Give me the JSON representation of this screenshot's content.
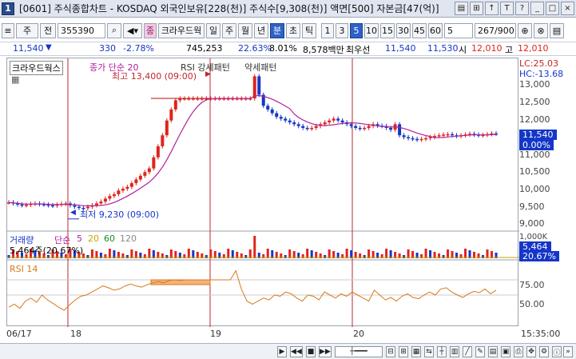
{
  "window": {
    "badge": "1",
    "title": "[0601] 주식종합차트 - KOSDAQ 외국인보유[228(천)] 주식수[9,308(천)] 액면[500] 자본금[47(억)]",
    "controls": [
      "▤",
      "⊞",
      "↑",
      "T",
      "?",
      "_",
      "□",
      "×"
    ]
  },
  "toolbar": {
    "menu_btn": "≡",
    "type_select": "주",
    "prev_btn": "전",
    "code": "355390",
    "search_icon": "⌕",
    "sound_icon": "◀▾",
    "stock_tag": "종",
    "stock_name": "크라우드웍",
    "periods": [
      "일",
      "주",
      "월",
      "년",
      "분",
      "초",
      "틱"
    ],
    "active_period": "분",
    "intervals": [
      "1",
      "3",
      "5",
      "10",
      "15",
      "30",
      "45",
      "60"
    ],
    "active_interval": "5",
    "interval_select": "5",
    "count": "267/900",
    "tools": [
      "⊕",
      "⊗",
      "▤"
    ]
  },
  "quote": {
    "price": "11,540",
    "arrow": "▼",
    "change": "330",
    "change_pct": "-2.78%",
    "volume": "745,253",
    "vol_ratio": "22.63%",
    "turnover": "8.01%",
    "amount": "8,578백만",
    "hoga_label": "최우선",
    "ask": "11,540",
    "bid": "11,530",
    "open_label": "시",
    "open": "12,010",
    "high_label": "고",
    "high": "12,010"
  },
  "price_panel": {
    "legend_name": "크라우드웍스",
    "legend_ma": "종가 단순 20",
    "legend_rsi_pattern": "RSI 강세패턴",
    "legend_weak": "약세패턴",
    "max_label": "최고 13,400 (09:00)",
    "min_label": "최저 9,230 (09:00)",
    "lc": "LC:25.03",
    "hc": "HC:-13.68",
    "y_ticks": [
      "13,000",
      "12,500",
      "12,000",
      "11,000",
      "10,500",
      "10,000",
      "9,500",
      "9,000"
    ],
    "last_price": "11,540",
    "last_pct": "0.00%"
  },
  "volume_panel": {
    "label": "거래량",
    "ma_label": "단순",
    "ma_periods": [
      "5",
      "20",
      "60",
      "120"
    ],
    "current": "5,464주(20.67%)",
    "axis_top": "1,000K",
    "last_value": "5,464",
    "last_pct": "20.67%"
  },
  "rsi_panel": {
    "label": "RSI 14",
    "ticks": [
      "75.00",
      "50.00"
    ]
  },
  "dates": [
    "06/17",
    "18",
    "19",
    "20"
  ],
  "time_label": "15:35:00",
  "colors": {
    "up": "#e0241b",
    "down": "#1436c8",
    "ma20": "#b0209a",
    "rsi": "#d9781c",
    "divider": "#c1272d"
  },
  "chart_data": {
    "type": "candlestick",
    "interval": "5min",
    "series_ma": "종가 단순 20",
    "ylim": [
      8900,
      13500
    ],
    "dates": [
      "06/17",
      "06/18",
      "06/19",
      "06/20"
    ],
    "close_path": [
      9680,
      9650,
      9620,
      9600,
      9610,
      9640,
      9650,
      9630,
      9620,
      9600,
      9590,
      9620,
      9640,
      9650,
      9600,
      9560,
      9530,
      9520,
      9560,
      9600,
      9650,
      9700,
      9780,
      9850,
      9900,
      10000,
      10050,
      10100,
      10200,
      10300,
      10400,
      10500,
      10600,
      10900,
      11200,
      11500,
      11900,
      12200,
      12450,
      12500,
      12500,
      12500,
      12500,
      12500,
      12500,
      12500,
      12500,
      12500,
      12500,
      12500,
      12500,
      12500,
      12500,
      12500,
      12500,
      12500,
      13100,
      12600,
      12300,
      12200,
      12100,
      12000,
      11950,
      11900,
      11850,
      11800,
      11750,
      11700,
      11680,
      11700,
      11750,
      11800,
      11850,
      11900,
      11950,
      11900,
      11850,
      11800,
      11750,
      11700,
      11680,
      11700,
      11750,
      11800,
      11760,
      11750,
      11700,
      11650,
      11800,
      11500,
      11450,
      11420,
      11400,
      11380,
      11400,
      11420,
      11450,
      11480,
      11500,
      11520,
      11530,
      11500,
      11480,
      11500,
      11520,
      11540,
      11520,
      11500,
      11510,
      11530,
      11550,
      11540
    ],
    "high": 13400,
    "low": 9230,
    "last": 11540,
    "rsi_values": [
      30,
      35,
      28,
      40,
      45,
      38,
      50,
      42,
      36,
      30,
      25,
      34,
      42,
      48,
      50,
      55,
      60,
      65,
      62,
      58,
      60,
      65,
      68,
      65,
      63,
      67,
      70,
      72,
      70,
      74,
      75,
      74,
      75,
      75,
      75,
      75,
      75,
      75,
      75,
      75,
      75,
      90,
      60,
      40,
      35,
      40,
      45,
      42,
      50,
      48,
      55,
      52,
      45,
      40,
      50,
      48,
      42,
      55,
      50,
      45,
      52,
      48,
      55,
      50,
      45,
      40,
      58,
      50,
      42,
      46,
      40,
      48,
      52,
      46,
      44,
      50,
      55,
      50,
      60,
      62,
      55,
      50,
      46,
      52,
      56,
      54,
      60,
      52,
      58
    ]
  }
}
